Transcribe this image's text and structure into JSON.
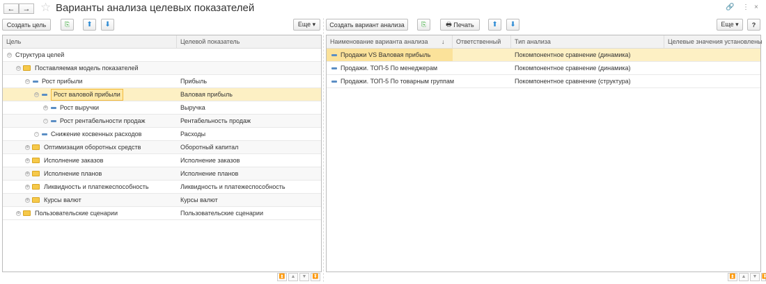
{
  "window": {
    "title": "Варианты анализа целевых показателей",
    "back": "←",
    "forward": "→"
  },
  "left": {
    "toolbar": {
      "create": "Создать цель",
      "more": "Еще ▾"
    },
    "columns": [
      "Цель",
      "Целевой показатель"
    ],
    "rows": [
      {
        "level": 0,
        "toggle": "⊖",
        "icon": "none",
        "name": "Структура целей",
        "target": ""
      },
      {
        "level": 1,
        "toggle": "⊖",
        "icon": "folder",
        "name": "Поставляемая модель показателей",
        "target": ""
      },
      {
        "level": 2,
        "toggle": "⊖",
        "icon": "dash",
        "name": "Рост прибыли",
        "target": "Прибыль"
      },
      {
        "level": 3,
        "toggle": "⊖",
        "icon": "dash",
        "name": "Рост валовой прибыли",
        "target": "Валовая прибыль",
        "selected": true
      },
      {
        "level": 4,
        "toggle": "⊕",
        "icon": "dash",
        "name": "Рост выручки",
        "target": "Выручка"
      },
      {
        "level": 4,
        "toggle": "○",
        "icon": "dash",
        "name": "Рост рентабельности продаж",
        "target": "Рентабельность продаж"
      },
      {
        "level": 3,
        "toggle": "○",
        "icon": "dash",
        "name": "Снижение косвенных расходов",
        "target": "Расходы"
      },
      {
        "level": 2,
        "toggle": "⊕",
        "icon": "folder",
        "name": "Оптимизация оборотных средств",
        "target": "Оборотный капитал"
      },
      {
        "level": 2,
        "toggle": "⊕",
        "icon": "folder",
        "name": "Исполнение заказов",
        "target": "Исполнение заказов"
      },
      {
        "level": 2,
        "toggle": "⊕",
        "icon": "folder",
        "name": "Исполнение планов",
        "target": "Исполнение планов"
      },
      {
        "level": 2,
        "toggle": "⊕",
        "icon": "folder",
        "name": "Ликвидность и платежеспособность",
        "target": "Ликвидность и платежеспособность"
      },
      {
        "level": 2,
        "toggle": "⊕",
        "icon": "folder",
        "name": "Курсы валют",
        "target": "Курсы валют"
      },
      {
        "level": 1,
        "toggle": "⊕",
        "icon": "folder",
        "name": "Пользовательские сценарии",
        "target": "Пользовательские сценарии"
      }
    ]
  },
  "right": {
    "toolbar": {
      "create": "Создать вариант анализа",
      "print": "Печать",
      "more": "Еще ▾",
      "help": "?"
    },
    "columns": [
      "Наименование варианта анализа",
      "Ответственный",
      "Тип анализа",
      "Целевые значения установлены"
    ],
    "sort_indicator": "↓",
    "rows": [
      {
        "name": "Продажи VS Валовая прибыль",
        "responsible": "",
        "type": "Покомпонентное сравнение (динамика)",
        "targets_set": "",
        "selected": true
      },
      {
        "name": "Продажи. ТОП-5 По менеджерам",
        "responsible": "",
        "type": "Покомпонентное сравнение (динамика)",
        "targets_set": ""
      },
      {
        "name": "Продажи. ТОП-5 По товарным группам",
        "responsible": "",
        "type": "Покомпонентное сравнение (структура)",
        "targets_set": ""
      }
    ]
  }
}
